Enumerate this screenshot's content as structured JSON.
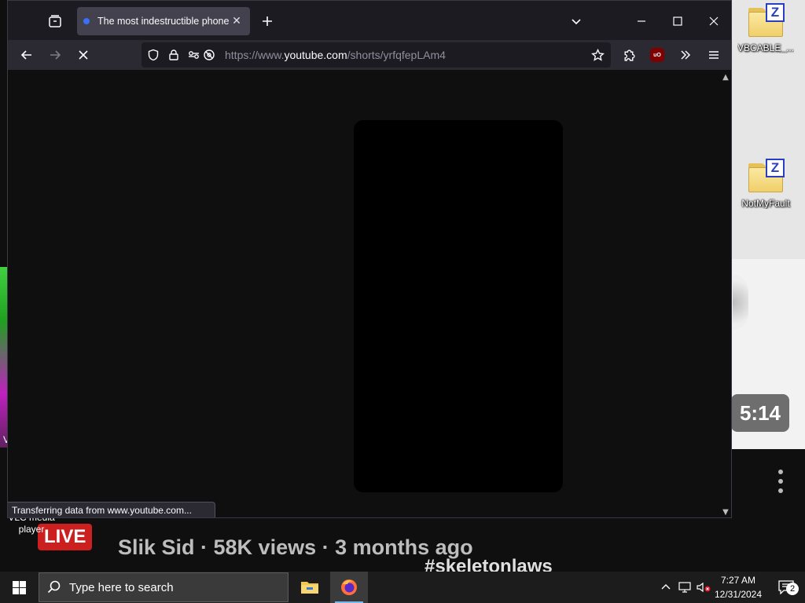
{
  "browser": {
    "tab": {
      "title": "The most indestructible phone"
    },
    "url": {
      "prefix": "https://www.",
      "host": "youtube.com",
      "path": "/shorts/yrfqfepLAm4"
    },
    "status_text": "Transferring data from www.youtube.com...",
    "icons": {
      "tab_overview": "tab-overview-icon",
      "new_tab": "plus-icon",
      "list_all_tabs": "chevron-down-icon",
      "minimize": "minimize-icon",
      "maximize": "maximize-icon",
      "close": "close-icon",
      "back": "arrow-left-icon",
      "forward": "arrow-right-icon",
      "stop": "stop-icon",
      "tracking_protection": "shield-icon",
      "secure": "lock-icon",
      "permissions": "permissions-icon",
      "bookmark": "star-icon",
      "extensions": "puzzle-icon",
      "ublock": "ublock-icon",
      "overflow": "double-chevron-icon",
      "menu": "hamburger-icon"
    },
    "ublock_label": "uO"
  },
  "background": {
    "duration": "5:14",
    "live_badge": "LIVE",
    "video_meta": "Slik Sid · 58K views · 3 months ago",
    "channel": "#skeletonlaws",
    "vlc_label": "VLC media player",
    "partial_letter": "V"
  },
  "desktop_icons": [
    {
      "label": "VBCABLE_...",
      "badge": "Z"
    },
    {
      "label": "NotMyFault",
      "badge": "Z"
    }
  ],
  "taskbar": {
    "search_placeholder": "Type here to search",
    "clock_time": "7:27 AM",
    "clock_date": "12/31/2024",
    "notification_count": "2"
  },
  "colors": {
    "accent": "#76b9ed",
    "live": "#cc1f1f",
    "ublock": "#800000",
    "browser_bg": "#1c1b22",
    "toolbar_bg": "#2b2a33"
  }
}
